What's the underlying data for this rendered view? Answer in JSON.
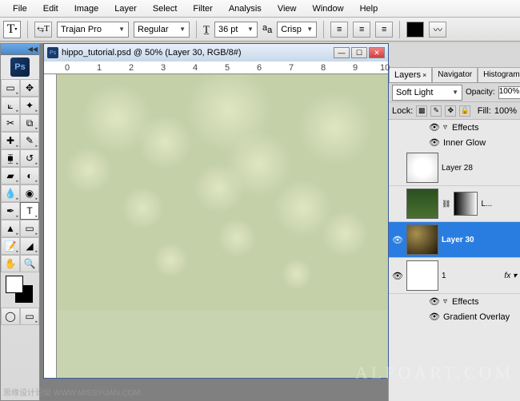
{
  "menu": {
    "items": [
      "File",
      "Edit",
      "Image",
      "Layer",
      "Select",
      "Filter",
      "Analysis",
      "View",
      "Window",
      "Help"
    ]
  },
  "options": {
    "font_family": "Trajan Pro",
    "font_style": "Regular",
    "font_size": "36 pt",
    "antialias_label": "a",
    "antialias_value": "Crisp"
  },
  "app_badge": "Ps",
  "document": {
    "title": "hippo_tutorial.psd @ 50% (Layer 30, RGB/8#)",
    "ruler_ticks": [
      "0",
      "1",
      "2",
      "3",
      "4",
      "5",
      "6",
      "7",
      "8",
      "9",
      "10"
    ]
  },
  "panels": {
    "tabs": [
      {
        "label": "Layers",
        "active": true
      },
      {
        "label": "Navigator",
        "active": false
      },
      {
        "label": "Histogram",
        "active": false
      }
    ],
    "blend_mode": "Soft Light",
    "opacity_label": "Opacity:",
    "opacity_value": "100%",
    "lock_label": "Lock:",
    "fill_label": "Fill:",
    "fill_value": "100%",
    "effects_label": "Effects",
    "inner_glow": "Inner Glow",
    "gradient_overlay": "Gradient Overlay",
    "layers": [
      {
        "name": "Layer 28",
        "visible": false,
        "selected": false,
        "thumb": "white-glow"
      },
      {
        "name": "L...",
        "visible": false,
        "selected": false,
        "thumb": "green-th",
        "mask": true
      },
      {
        "name": "Layer 30",
        "visible": true,
        "selected": true,
        "thumb": "bokeh-th"
      },
      {
        "name": "1",
        "visible": true,
        "selected": false,
        "thumb": "white",
        "fx": true
      }
    ]
  },
  "watermarks": {
    "left": "思缘设计论坛  WWW.MISSYUAN.COM",
    "right": "ALFOART.COM"
  }
}
